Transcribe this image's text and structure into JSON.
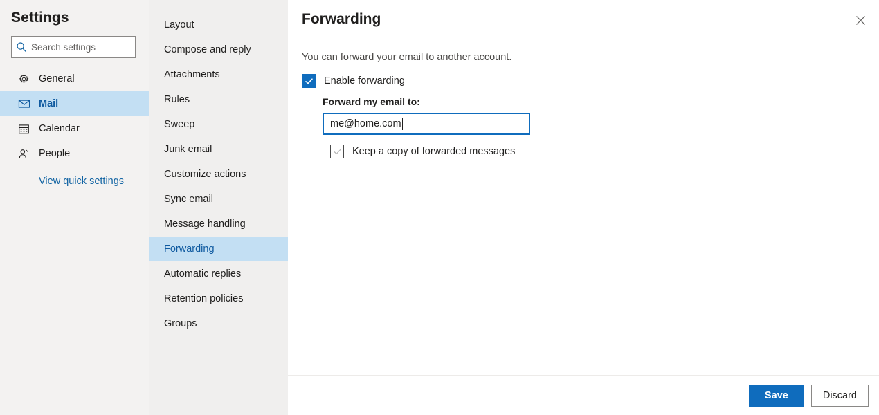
{
  "sidebar": {
    "title": "Settings",
    "search": {
      "placeholder": "Search settings",
      "value": "",
      "icon": "search-icon"
    },
    "items": [
      {
        "label": "General",
        "icon": "gear-icon",
        "selected": false
      },
      {
        "label": "Mail",
        "icon": "envelope-icon",
        "selected": true
      },
      {
        "label": "Calendar",
        "icon": "calendar-icon",
        "selected": false
      },
      {
        "label": "People",
        "icon": "person-icon",
        "selected": false
      }
    ],
    "quick_link": "View quick settings"
  },
  "subnav": {
    "items": [
      {
        "label": "Layout",
        "selected": false
      },
      {
        "label": "Compose and reply",
        "selected": false
      },
      {
        "label": "Attachments",
        "selected": false
      },
      {
        "label": "Rules",
        "selected": false
      },
      {
        "label": "Sweep",
        "selected": false
      },
      {
        "label": "Junk email",
        "selected": false
      },
      {
        "label": "Customize actions",
        "selected": false
      },
      {
        "label": "Sync email",
        "selected": false
      },
      {
        "label": "Message handling",
        "selected": false
      },
      {
        "label": "Forwarding",
        "selected": true
      },
      {
        "label": "Automatic replies",
        "selected": false
      },
      {
        "label": "Retention policies",
        "selected": false
      },
      {
        "label": "Groups",
        "selected": false
      }
    ]
  },
  "content": {
    "title": "Forwarding",
    "close_icon": "close-icon",
    "description": "You can forward your email to another account.",
    "enable_forwarding": {
      "label": "Enable forwarding",
      "checked": true
    },
    "forward_to": {
      "label": "Forward my email to:",
      "value": "me@home.com",
      "placeholder": ""
    },
    "keep_copy": {
      "label": "Keep a copy of forwarded messages",
      "checked": false
    }
  },
  "footer": {
    "save_label": "Save",
    "discard_label": "Discard"
  },
  "colors": {
    "accent": "#0f6cbd",
    "selection": "#c3dff3",
    "link": "#1264a3",
    "sidebar_bg": "#f3f2f1",
    "subnav_bg": "#f0efee"
  }
}
